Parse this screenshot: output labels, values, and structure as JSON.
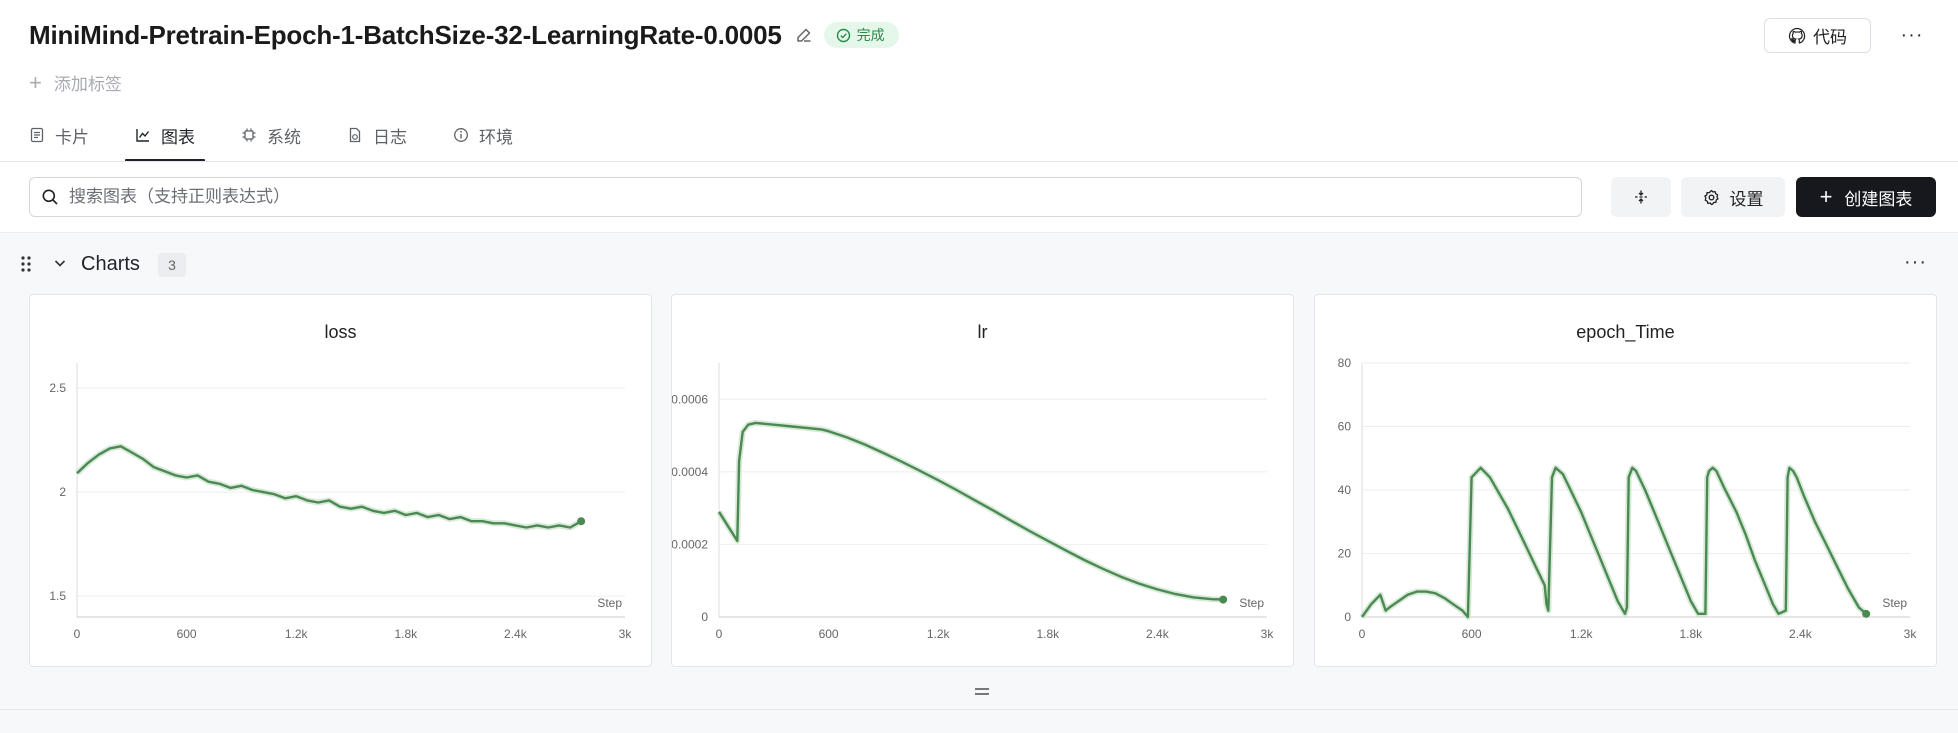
{
  "header": {
    "title": "MiniMind-Pretrain-Epoch-1-BatchSize-32-LearningRate-0.0005",
    "status": "完成",
    "add_tag": "添加标签",
    "code_button": "代码",
    "more": "···"
  },
  "tabs": [
    {
      "label": "卡片",
      "icon": "card-icon"
    },
    {
      "label": "图表",
      "icon": "line-chart-icon",
      "active": true
    },
    {
      "label": "系统",
      "icon": "chip-icon"
    },
    {
      "label": "日志",
      "icon": "log-icon"
    },
    {
      "label": "环境",
      "icon": "info-icon"
    }
  ],
  "toolbar": {
    "search_placeholder": "搜索图表（支持正则表达式）",
    "settings_label": "设置",
    "create_label": "创建图表"
  },
  "group": {
    "title": "Charts",
    "count": "3",
    "more": "···"
  },
  "colors": {
    "series": "#4a8a52",
    "series_raw": "#cfe3cf",
    "accent_dark": "#16181d",
    "status_green": "#2b8a4a"
  },
  "chart_data": [
    {
      "type": "line",
      "title": "loss",
      "xlabel": "Step",
      "xlim": [
        0,
        3000
      ],
      "x_ticks": [
        "0",
        "600",
        "1.2k",
        "1.8k",
        "2.4k",
        "3k"
      ],
      "x_tick_values": [
        0,
        600,
        1200,
        1800,
        2400,
        3000
      ],
      "ylim": [
        1.4,
        2.62
      ],
      "y_ticks": [
        "1.5",
        "2",
        "2.5"
      ],
      "y_tick_values": [
        1.5,
        2.0,
        2.5
      ],
      "series": [
        {
          "x": [
            0,
            60,
            120,
            180,
            240,
            300,
            360,
            420,
            480,
            540,
            600,
            660,
            720,
            780,
            840,
            900,
            960,
            1020,
            1080,
            1140,
            1200,
            1260,
            1320,
            1380,
            1440,
            1500,
            1560,
            1620,
            1680,
            1740,
            1800,
            1860,
            1920,
            1980,
            2040,
            2100,
            2160,
            2220,
            2280,
            2340,
            2400,
            2460,
            2520,
            2580,
            2640,
            2700,
            2760
          ],
          "y": [
            2.09,
            2.14,
            2.18,
            2.21,
            2.22,
            2.19,
            2.16,
            2.12,
            2.1,
            2.08,
            2.07,
            2.08,
            2.05,
            2.04,
            2.02,
            2.03,
            2.01,
            2.0,
            1.99,
            1.97,
            1.98,
            1.96,
            1.95,
            1.96,
            1.93,
            1.92,
            1.93,
            1.91,
            1.9,
            1.91,
            1.89,
            1.9,
            1.88,
            1.89,
            1.87,
            1.88,
            1.86,
            1.86,
            1.85,
            1.85,
            1.84,
            1.83,
            1.84,
            1.83,
            1.84,
            1.83,
            1.86
          ]
        }
      ]
    },
    {
      "type": "line",
      "title": "lr",
      "xlabel": "Step",
      "xlim": [
        0,
        3000
      ],
      "x_ticks": [
        "0",
        "600",
        "1.2k",
        "1.8k",
        "2.4k",
        "3k"
      ],
      "x_tick_values": [
        0,
        600,
        1200,
        1800,
        2400,
        3000
      ],
      "ylim": [
        0,
        0.0007
      ],
      "y_ticks": [
        "0",
        "0.0002",
        "0.0004",
        "0.0006"
      ],
      "y_tick_values": [
        0,
        0.0002,
        0.0004,
        0.0006
      ],
      "series": [
        {
          "x": [
            0,
            50,
            100,
            110,
            130,
            160,
            200,
            300,
            400,
            500,
            560,
            600,
            700,
            800,
            900,
            1000,
            1100,
            1200,
            1300,
            1400,
            1500,
            1600,
            1700,
            1800,
            1900,
            2000,
            2100,
            2200,
            2300,
            2400,
            2500,
            2600,
            2700,
            2760
          ],
          "y": [
            0.00029,
            0.00025,
            0.00021,
            0.00043,
            0.00051,
            0.00053,
            0.000535,
            0.00053,
            0.000525,
            0.00052,
            0.000517,
            0.000512,
            0.000495,
            0.000475,
            0.000452,
            0.000428,
            0.000403,
            0.000377,
            0.00035,
            0.000322,
            0.000294,
            0.000265,
            0.000237,
            0.00021,
            0.000183,
            0.000157,
            0.000133,
            0.000111,
            9.2e-05,
            7.6e-05,
            6.3e-05,
            5.4e-05,
            4.9e-05,
            4.8e-05
          ]
        }
      ]
    },
    {
      "type": "line",
      "title": "epoch_Time",
      "xlabel": "Step",
      "xlim": [
        0,
        3000
      ],
      "x_ticks": [
        "0",
        "600",
        "1.2k",
        "1.8k",
        "2.4k",
        "3k"
      ],
      "x_tick_values": [
        0,
        600,
        1200,
        1800,
        2400,
        3000
      ],
      "ylim": [
        0,
        80
      ],
      "y_ticks": [
        "0",
        "20",
        "40",
        "60",
        "80"
      ],
      "y_tick_values": [
        0,
        20,
        40,
        60,
        80
      ],
      "series": [
        {
          "x": [
            0,
            50,
            100,
            130,
            150,
            200,
            250,
            300,
            350,
            400,
            450,
            500,
            550,
            565,
            580,
            600,
            650,
            700,
            750,
            800,
            850,
            900,
            950,
            1000,
            1010,
            1020,
            1040,
            1060,
            1100,
            1150,
            1200,
            1250,
            1300,
            1350,
            1400,
            1440,
            1450,
            1460,
            1480,
            1500,
            1550,
            1600,
            1650,
            1700,
            1750,
            1800,
            1840,
            1880,
            1890,
            1900,
            1920,
            1940,
            1980,
            2050,
            2100,
            2150,
            2200,
            2250,
            2280,
            2320,
            2330,
            2340,
            2360,
            2380,
            2420,
            2480,
            2540,
            2600,
            2660,
            2720,
            2760
          ],
          "y": [
            0,
            4,
            7,
            2,
            3,
            5,
            7,
            8,
            8,
            7.5,
            6,
            4,
            2,
            1,
            0,
            44,
            47,
            44,
            39,
            34,
            28,
            22,
            16,
            10,
            4,
            2,
            44,
            47,
            45,
            39,
            33,
            26,
            19,
            12,
            5,
            1,
            3,
            44,
            47,
            46,
            40,
            33,
            26,
            19,
            12,
            5,
            1,
            1,
            44,
            46,
            47,
            46,
            41,
            33,
            26,
            18,
            11,
            4,
            1,
            2,
            44,
            47,
            46,
            44,
            38,
            30,
            23,
            16,
            9,
            3,
            1
          ]
        }
      ]
    }
  ]
}
